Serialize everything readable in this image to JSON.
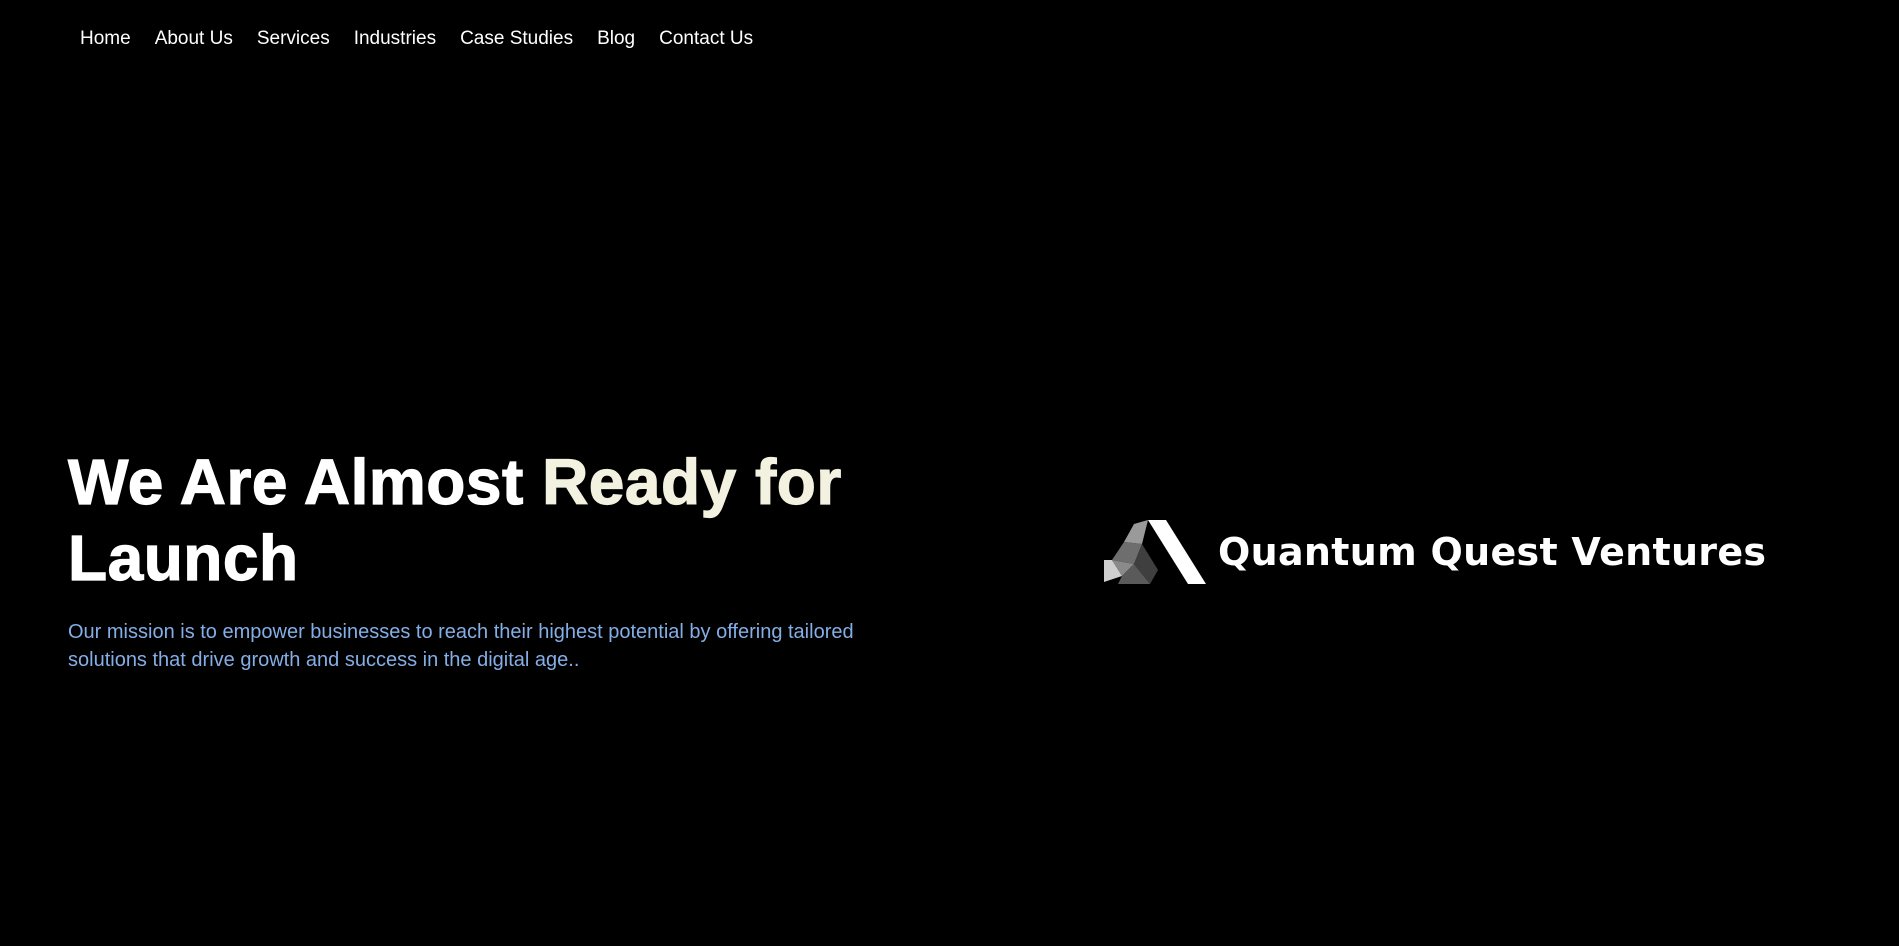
{
  "nav": {
    "items": [
      {
        "label": "Home"
      },
      {
        "label": "About Us"
      },
      {
        "label": "Services"
      },
      {
        "label": "Industries"
      },
      {
        "label": "Case Studies"
      },
      {
        "label": "Blog"
      },
      {
        "label": "Contact Us"
      }
    ]
  },
  "hero": {
    "title_part1": "We Are Almost ",
    "title_part2": "Ready for",
    "title_part3": "Launch",
    "subtitle": "Our mission is to empower businesses to reach their highest potential by offering tailored solutions that drive growth and success in the digital age.."
  },
  "brand": {
    "name": "Quantum Quest Ventures",
    "logo_icon": "triangle-logo-icon"
  },
  "colors": {
    "background": "#000000",
    "text": "#ffffff",
    "title_accent": "#f3f1df",
    "subtitle": "#84aee6"
  }
}
